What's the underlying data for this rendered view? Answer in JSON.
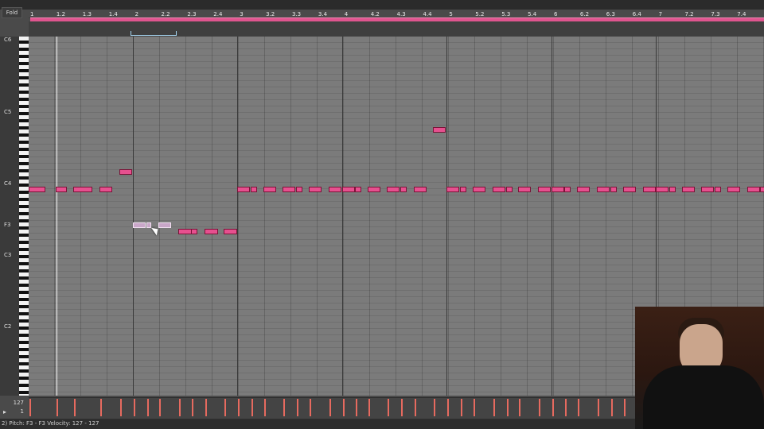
{
  "header": {
    "fold_label": "Fold"
  },
  "ruler": {
    "ticks": [
      "1",
      "1.2",
      "1.3",
      "1.4",
      "2",
      "2.2",
      "2.3",
      "2.4",
      "3",
      "3.2",
      "3.3",
      "3.4",
      "4",
      "4.2",
      "4.3",
      "4.4",
      "5",
      "5.2",
      "5.3",
      "5.4",
      "6",
      "6.2",
      "6.3",
      "6.4",
      "7",
      "7.2",
      "7.3",
      "7.4"
    ]
  },
  "keyboard": {
    "labels": [
      "C6",
      "C5",
      "C4",
      "F3",
      "C3",
      "C2"
    ]
  },
  "velocity": {
    "top_label": "127",
    "bottom_label": "1",
    "play_glyph": "▸"
  },
  "status_bar": {
    "text": "2)    Pitch: F3 - F3    Velocity: 127 - 127"
  },
  "notes": {
    "count_visible": 60,
    "color": "#e6508f",
    "selected_color": "#c9a7c9"
  },
  "colors": {
    "accent": "#e0558f",
    "playhead": "#f6f6f6"
  },
  "icons": {
    "cursor": "pointer-arrow-icon",
    "webcam": "presenter-video-icon"
  }
}
